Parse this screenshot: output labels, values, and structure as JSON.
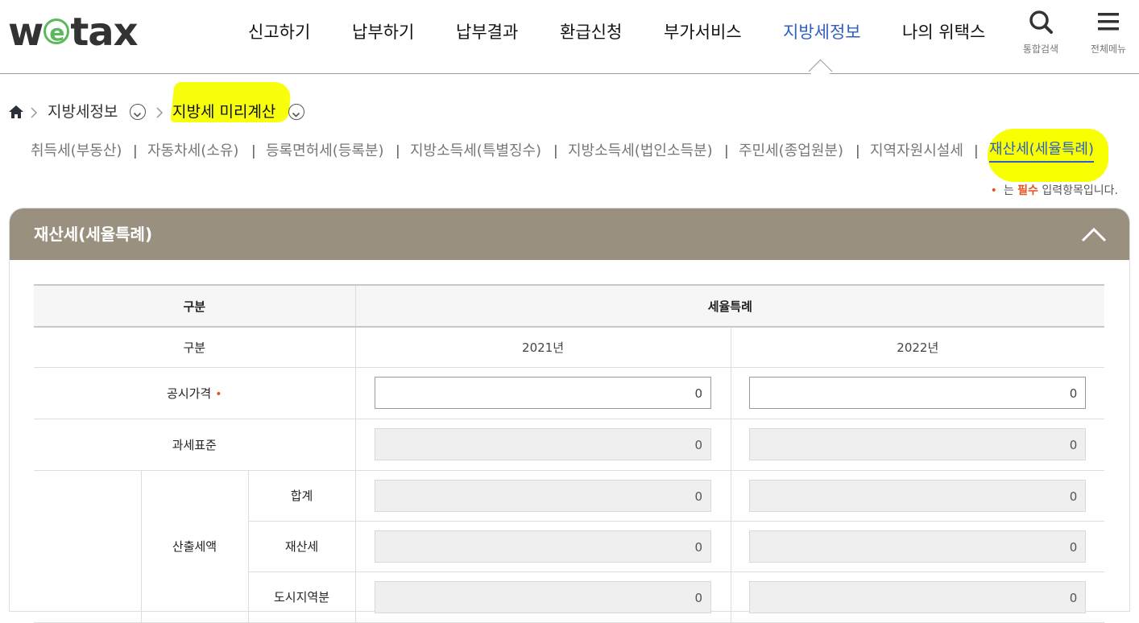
{
  "header": {
    "logo": {
      "left": "w",
      "e": "e",
      "right": "tax"
    },
    "nav": [
      {
        "label": "신고하기"
      },
      {
        "label": "납부하기"
      },
      {
        "label": "납부결과"
      },
      {
        "label": "환급신청"
      },
      {
        "label": "부가서비스"
      },
      {
        "label": "지방세정보",
        "active": true
      },
      {
        "label": "나의 위택스"
      }
    ],
    "search_label": "통합검색",
    "menu_label": "전체메뉴",
    "icons": {
      "search": "search-icon",
      "menu": "hamburger-menu-icon"
    }
  },
  "breadcrumb": {
    "home_icon": "home-icon",
    "level1": "지방세정보",
    "level2": "지방세 미리계산"
  },
  "tabs": [
    {
      "label": "취득세(부동산)"
    },
    {
      "label": "자동차세(소유)"
    },
    {
      "label": "등록면허세(등록분)"
    },
    {
      "label": "지방소득세(특별징수)"
    },
    {
      "label": "지방소득세(법인소득분)"
    },
    {
      "label": "주민세(종업원분)"
    },
    {
      "label": "지역자원시설세"
    },
    {
      "label": "재산세(세율특례)",
      "active": true
    }
  ],
  "required_note": {
    "mark": "•",
    "prefix": "는 ",
    "must": "필수",
    "suffix": " 입력항목입니다."
  },
  "panel": {
    "title": "재산세(세율특례)",
    "collapse_icon": "chevron-up-icon",
    "table": {
      "head_left": "구분",
      "head_right": "세율특례",
      "row_year": {
        "label": "구분",
        "y1": "2021년",
        "y2": "2022년"
      },
      "row_price": {
        "label": "공시가격",
        "mark": "•",
        "v1": "0",
        "v2": "0"
      },
      "row_base": {
        "label": "과세표준",
        "v1": "0",
        "v2": "0"
      },
      "group_label": "산출세액",
      "sub": [
        {
          "label": "합계",
          "v1": "0",
          "v2": "0"
        },
        {
          "label": "재산세",
          "v1": "0",
          "v2": "0"
        },
        {
          "label": "도시지역분",
          "v1": "0",
          "v2": "0"
        }
      ]
    }
  },
  "colors": {
    "active_blue": "#2f5fc4",
    "panel_head": "#9a9080",
    "required": "#e2531f",
    "highlight": "#f7ff00"
  }
}
